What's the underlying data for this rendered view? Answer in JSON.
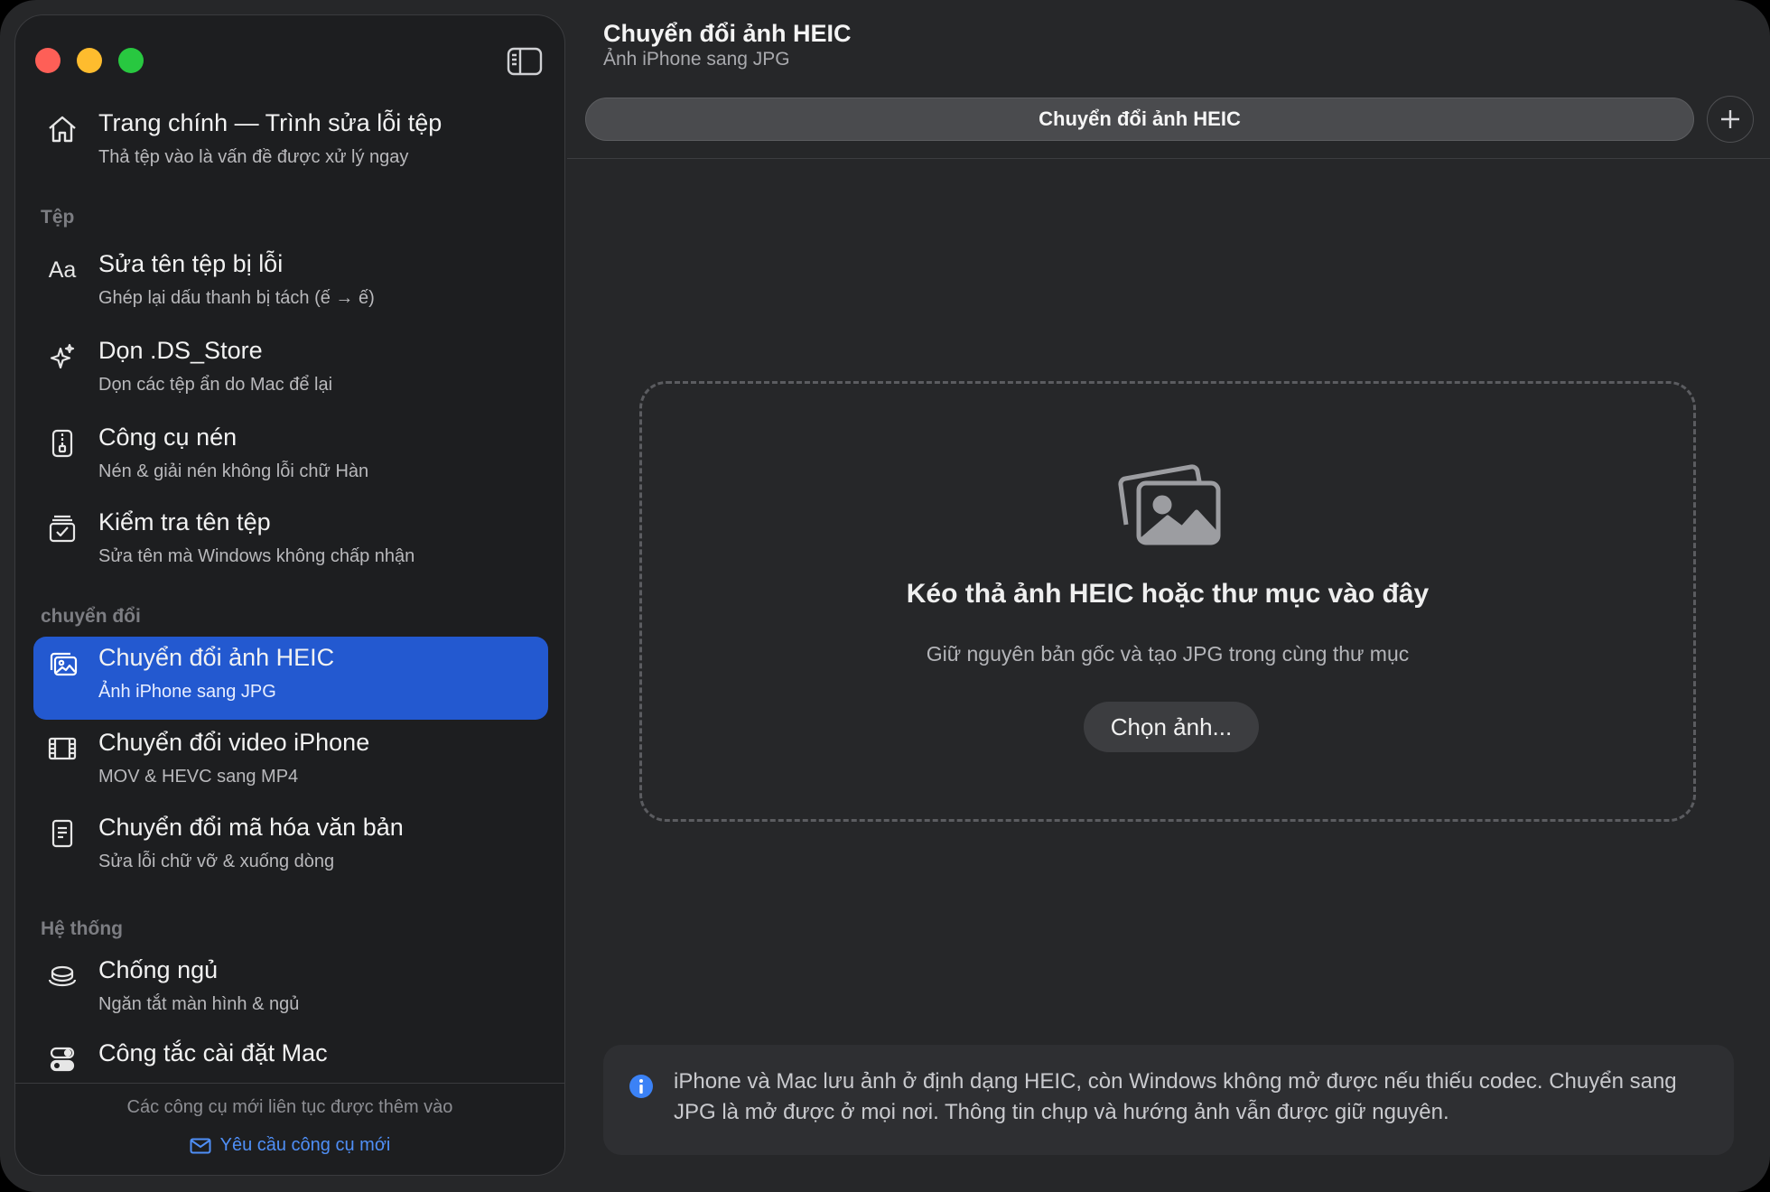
{
  "window": {
    "title": "Chuyển đổi ảnh HEIC",
    "subtitle": "Ảnh iPhone sang JPG"
  },
  "sidebar": {
    "home": {
      "title": "Trang chính — Trình sửa lỗi tệp",
      "subtitle": "Thả tệp vào là vấn đề được xử lý ngay",
      "icon": "house-icon"
    },
    "sections": {
      "files": "Tệp",
      "convert": "chuyển đổi",
      "system": "Hệ thống"
    },
    "items": [
      {
        "title": "Sửa tên tệp bị lỗi",
        "subtitle": "Ghép lại dấu thanh bị tách (ế → ế)",
        "icon": "text-aa-icon"
      },
      {
        "title": "Dọn .DS_Store",
        "subtitle": "Dọn các tệp ẩn do Mac để lại",
        "icon": "sparkle-icon"
      },
      {
        "title": "Công cụ nén",
        "subtitle": "Nén & giải nén không lỗi chữ Hàn",
        "icon": "zip-file-icon"
      },
      {
        "title": "Kiểm tra tên tệp",
        "subtitle": "Sửa tên mà Windows không chấp nhận",
        "icon": "checklist-icon"
      },
      {
        "title": "Chuyển đổi ảnh HEIC",
        "subtitle": "Ảnh iPhone sang JPG",
        "icon": "photos-icon",
        "selected": true
      },
      {
        "title": "Chuyển đổi video iPhone",
        "subtitle": "MOV & HEVC sang MP4",
        "icon": "film-icon"
      },
      {
        "title": "Chuyển đổi mã hóa văn bản",
        "subtitle": "Sửa lỗi chữ vỡ & xuống dòng",
        "icon": "document-icon"
      },
      {
        "title": "Chống ngủ",
        "subtitle": "Ngăn tắt màn hình & ngủ",
        "icon": "coffee-cup-icon"
      },
      {
        "title": "Công tắc cài đặt Mac",
        "subtitle": "",
        "icon": "toggles-icon"
      }
    ],
    "footer": {
      "note": "Các công cụ mới liên tục được thêm vào",
      "link": "Yêu cầu công cụ mới"
    }
  },
  "tabs": [
    {
      "label": "Chuyển đổi ảnh HEIC"
    }
  ],
  "drop_zone": {
    "title": "Kéo thả ảnh HEIC hoặc thư mục vào đây",
    "subtitle": "Giữ nguyên bản gốc và tạo JPG trong cùng thư mục",
    "button": "Chọn ảnh..."
  },
  "info": {
    "text": "iPhone và Mac lưu ảnh ở định dạng HEIC, còn Windows không mở được nếu thiếu codec. Chuyển sang JPG là mở được ở mọi nơi. Thông tin chụp và hướng ảnh vẫn được giữ nguyên."
  },
  "colors": {
    "accent": "#2359d0",
    "link": "#4f8ff7",
    "close": "#fe5f57",
    "minimize": "#febc2e",
    "zoom": "#28c840"
  }
}
